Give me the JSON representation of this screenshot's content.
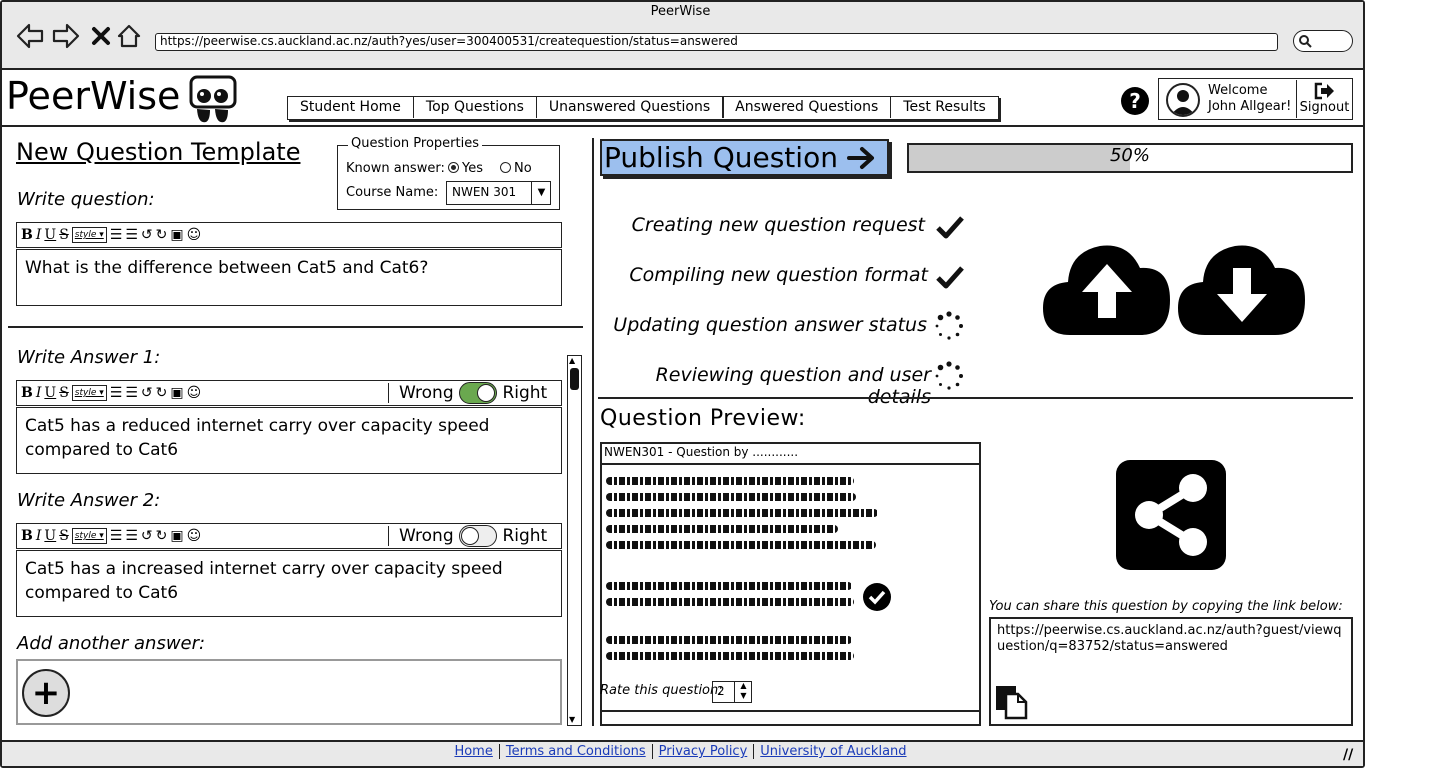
{
  "window": {
    "title": "PeerWise",
    "url": "https://peerwise.cs.auckland.ac.nz/auth?yes/user=300400531/createquestion/status=answered"
  },
  "header": {
    "logo": "PeerWise",
    "tabs": [
      {
        "label": "Student Home"
      },
      {
        "label": "Top Questions"
      },
      {
        "label": "Unanswered Questions"
      },
      {
        "label": "Answered Questions"
      },
      {
        "label": "Test Results"
      }
    ],
    "help": "?",
    "welcome_line1": "Welcome",
    "welcome_line2": "John Allgear!",
    "signout": "Signout"
  },
  "template": {
    "title": "New Question Template",
    "write_question_label": "Write question:",
    "question_text": "What is the difference between Cat5 and Cat6?",
    "properties": {
      "legend": "Question Properties",
      "known_answer_label": "Known answer:",
      "yes": "Yes",
      "no": "No",
      "known_answer_value": "Yes",
      "course_label": "Course Name:",
      "course_value": "NWEN 301"
    },
    "answers": [
      {
        "label": "Write Answer 1:",
        "text": "Cat5 has a reduced internet carry over capacity speed compared to Cat6",
        "wrong": "Wrong",
        "right": "Right",
        "is_right": true
      },
      {
        "label": "Write Answer 2:",
        "text": "Cat5 has a increased internet carry over capacity speed compared to Cat6",
        "wrong": "Wrong",
        "right": "Right",
        "is_right": false
      }
    ],
    "add_answer_label": "Add another answer:"
  },
  "publish": {
    "button": "Publish Question",
    "progress_text": "50%",
    "progress": 0.5,
    "steps": [
      {
        "label": "Creating new question request",
        "status": "done"
      },
      {
        "label": "Compiling new question format",
        "status": "done"
      },
      {
        "label": "Updating question answer status",
        "status": "loading"
      },
      {
        "label": "Reviewing question and user details",
        "status": "loading"
      }
    ]
  },
  "preview": {
    "title": "Question  Preview:",
    "header": "NWEN301 - Question by ............",
    "rate_label": "Rate this question:",
    "rate_value": "2",
    "share_label": "You can share this question by copying the link below:",
    "share_link": "https://peerwise.cs.auckland.ac.nz/auth?guest/viewquestion/q=83752/status=answered"
  },
  "footer": {
    "links": [
      "Home",
      "Terms and Conditions",
      "Privacy Policy",
      "University of Auckland"
    ]
  },
  "colors": {
    "publish_bg": "#9cbfee",
    "toggle_on": "#6aa84f",
    "link": "#1a3bb8"
  }
}
